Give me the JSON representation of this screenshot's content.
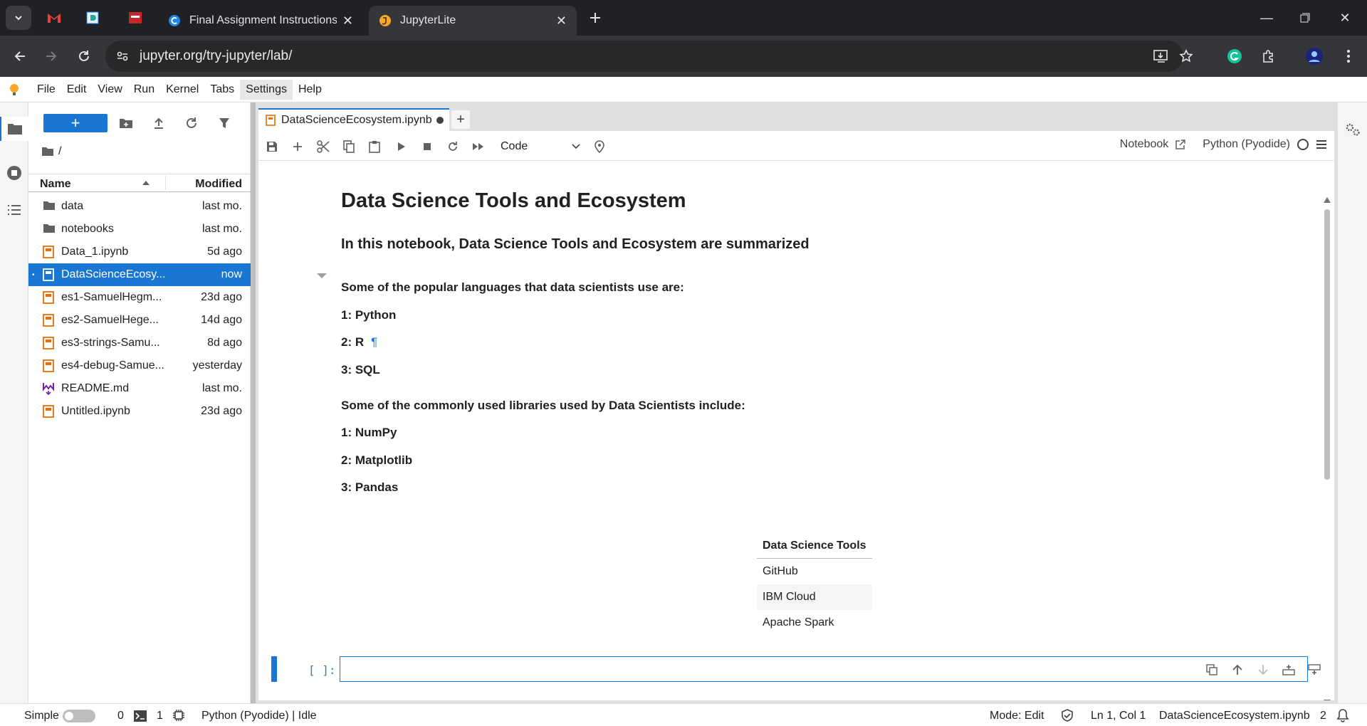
{
  "browser": {
    "tabs": [
      {
        "title": "Final Assignment Instructions: C",
        "active": false
      },
      {
        "title": "JupyterLite",
        "active": true
      }
    ],
    "url": "jupyter.org/try-jupyter/lab/"
  },
  "menubar": {
    "items": [
      "File",
      "Edit",
      "View",
      "Run",
      "Kernel",
      "Tabs",
      "Settings",
      "Help"
    ],
    "highlighted": "Settings"
  },
  "filebrowser": {
    "new_label": "+",
    "path": "/",
    "col_name": "Name",
    "col_modified": "Modified",
    "files": [
      {
        "name": "data",
        "modified": "last mo.",
        "type": "folder"
      },
      {
        "name": "notebooks",
        "modified": "last mo.",
        "type": "folder"
      },
      {
        "name": "Data_1.ipynb",
        "modified": "5d ago",
        "type": "notebook"
      },
      {
        "name": "DataScienceEcosy...",
        "modified": "now",
        "type": "notebook",
        "selected": true,
        "running": "•"
      },
      {
        "name": "es1-SamuelHegm...",
        "modified": "23d ago",
        "type": "notebook"
      },
      {
        "name": "es2-SamuelHege...",
        "modified": "14d ago",
        "type": "notebook"
      },
      {
        "name": "es3-strings-Samu...",
        "modified": "8d ago",
        "type": "notebook"
      },
      {
        "name": "es4-debug-Samue...",
        "modified": "yesterday",
        "type": "notebook"
      },
      {
        "name": "README.md",
        "modified": "last mo.",
        "type": "markdown"
      },
      {
        "name": "Untitled.ipynb",
        "modified": "23d ago",
        "type": "notebook"
      }
    ]
  },
  "notebook": {
    "tab_title": "DataScienceEcosystem.ipynb",
    "add_tab": "+",
    "cell_type": "Code",
    "notebook_label": "Notebook",
    "kernel_name": "Python (Pyodide)",
    "h1": "Data Science Tools and Ecosystem",
    "h3": "In this notebook, Data Science Tools and Ecosystem are summarized",
    "languages_intro": "Some of the popular languages that data scientists use are:",
    "languages": [
      "1: Python",
      "2: R",
      "3: SQL"
    ],
    "pilcrow": "¶",
    "libraries_intro": "Some of the commonly used libraries used by Data Scientists include:",
    "libraries": [
      "1: NumPy",
      "2: Matplotlib",
      "3: Pandas"
    ],
    "table_header": "Data Science Tools",
    "table_rows": [
      "GitHub",
      "IBM Cloud",
      "Apache Spark"
    ],
    "prompt": "[ ]:"
  },
  "statusbar": {
    "mode_simple": "Simple",
    "terminals": "0",
    "kernels": "1",
    "kernel_status": "Python (Pyodide) | Idle",
    "mode": "Mode: Edit",
    "cursor": "Ln 1, Col 1",
    "filename": "DataScienceEcosystem.ipynb",
    "notifications": "2"
  }
}
